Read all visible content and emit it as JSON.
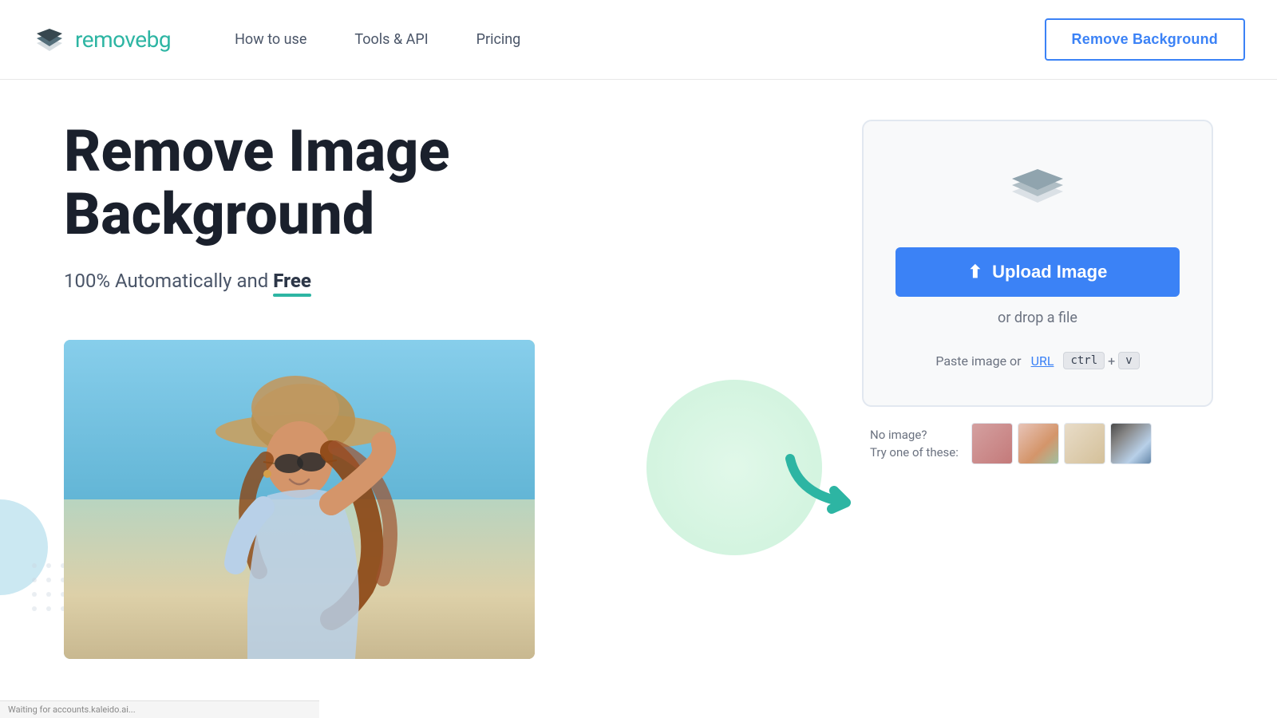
{
  "header": {
    "logo_text_dark": "remove",
    "logo_text_accent": "bg",
    "nav": {
      "how_to_use": "How to use",
      "tools_api": "Tools & API",
      "pricing": "Pricing"
    },
    "remove_background_btn": "Remove Background"
  },
  "hero": {
    "title_line1": "Remove Image",
    "title_line2": "Background",
    "subtitle_prefix": "100% Automatically and ",
    "subtitle_free": "Free"
  },
  "upload_panel": {
    "upload_btn_label": "Upload Image",
    "drop_text": "or drop a file",
    "paste_prefix": "Paste image or ",
    "paste_url": "URL",
    "kbd_ctrl": "ctrl",
    "kbd_plus": "+",
    "kbd_v": "v",
    "no_image_line1": "No image?",
    "no_image_line2": "Try one of these:"
  },
  "status_bar": {
    "text": "Waiting for accounts.kaleido.ai..."
  }
}
